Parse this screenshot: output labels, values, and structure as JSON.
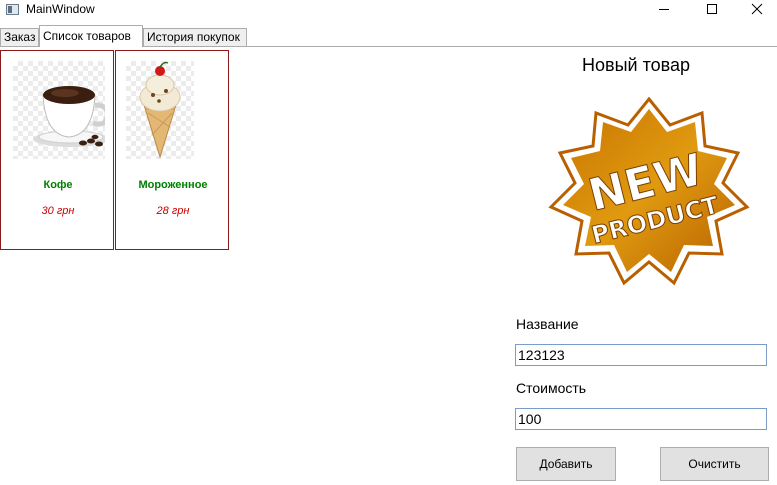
{
  "window": {
    "title": "MainWindow"
  },
  "tabs": [
    {
      "label": "Заказ",
      "selected": false
    },
    {
      "label": "Список товаров",
      "selected": true
    },
    {
      "label": "История покупок",
      "selected": false
    }
  ],
  "products": [
    {
      "name": "Кофе",
      "price": "30 грн",
      "image": "coffee-cup-icon"
    },
    {
      "name": "Мороженное",
      "price": "28 грн",
      "image": "ice-cream-cone-icon"
    }
  ],
  "form": {
    "title": "Новый товар",
    "badge_image": "new-product-badge",
    "name_label": "Название",
    "name_value": "123123",
    "cost_label": "Стоимость",
    "cost_value": "100",
    "add_button": "Добавить",
    "clear_button": "Очистить"
  },
  "colors": {
    "card_border": "#8b1a1a",
    "product_name": "#008000",
    "product_price": "#cc0000",
    "badge_orange": "#d98a00",
    "input_border": "#7a9cc6",
    "button_bg": "#e1e1e1"
  }
}
